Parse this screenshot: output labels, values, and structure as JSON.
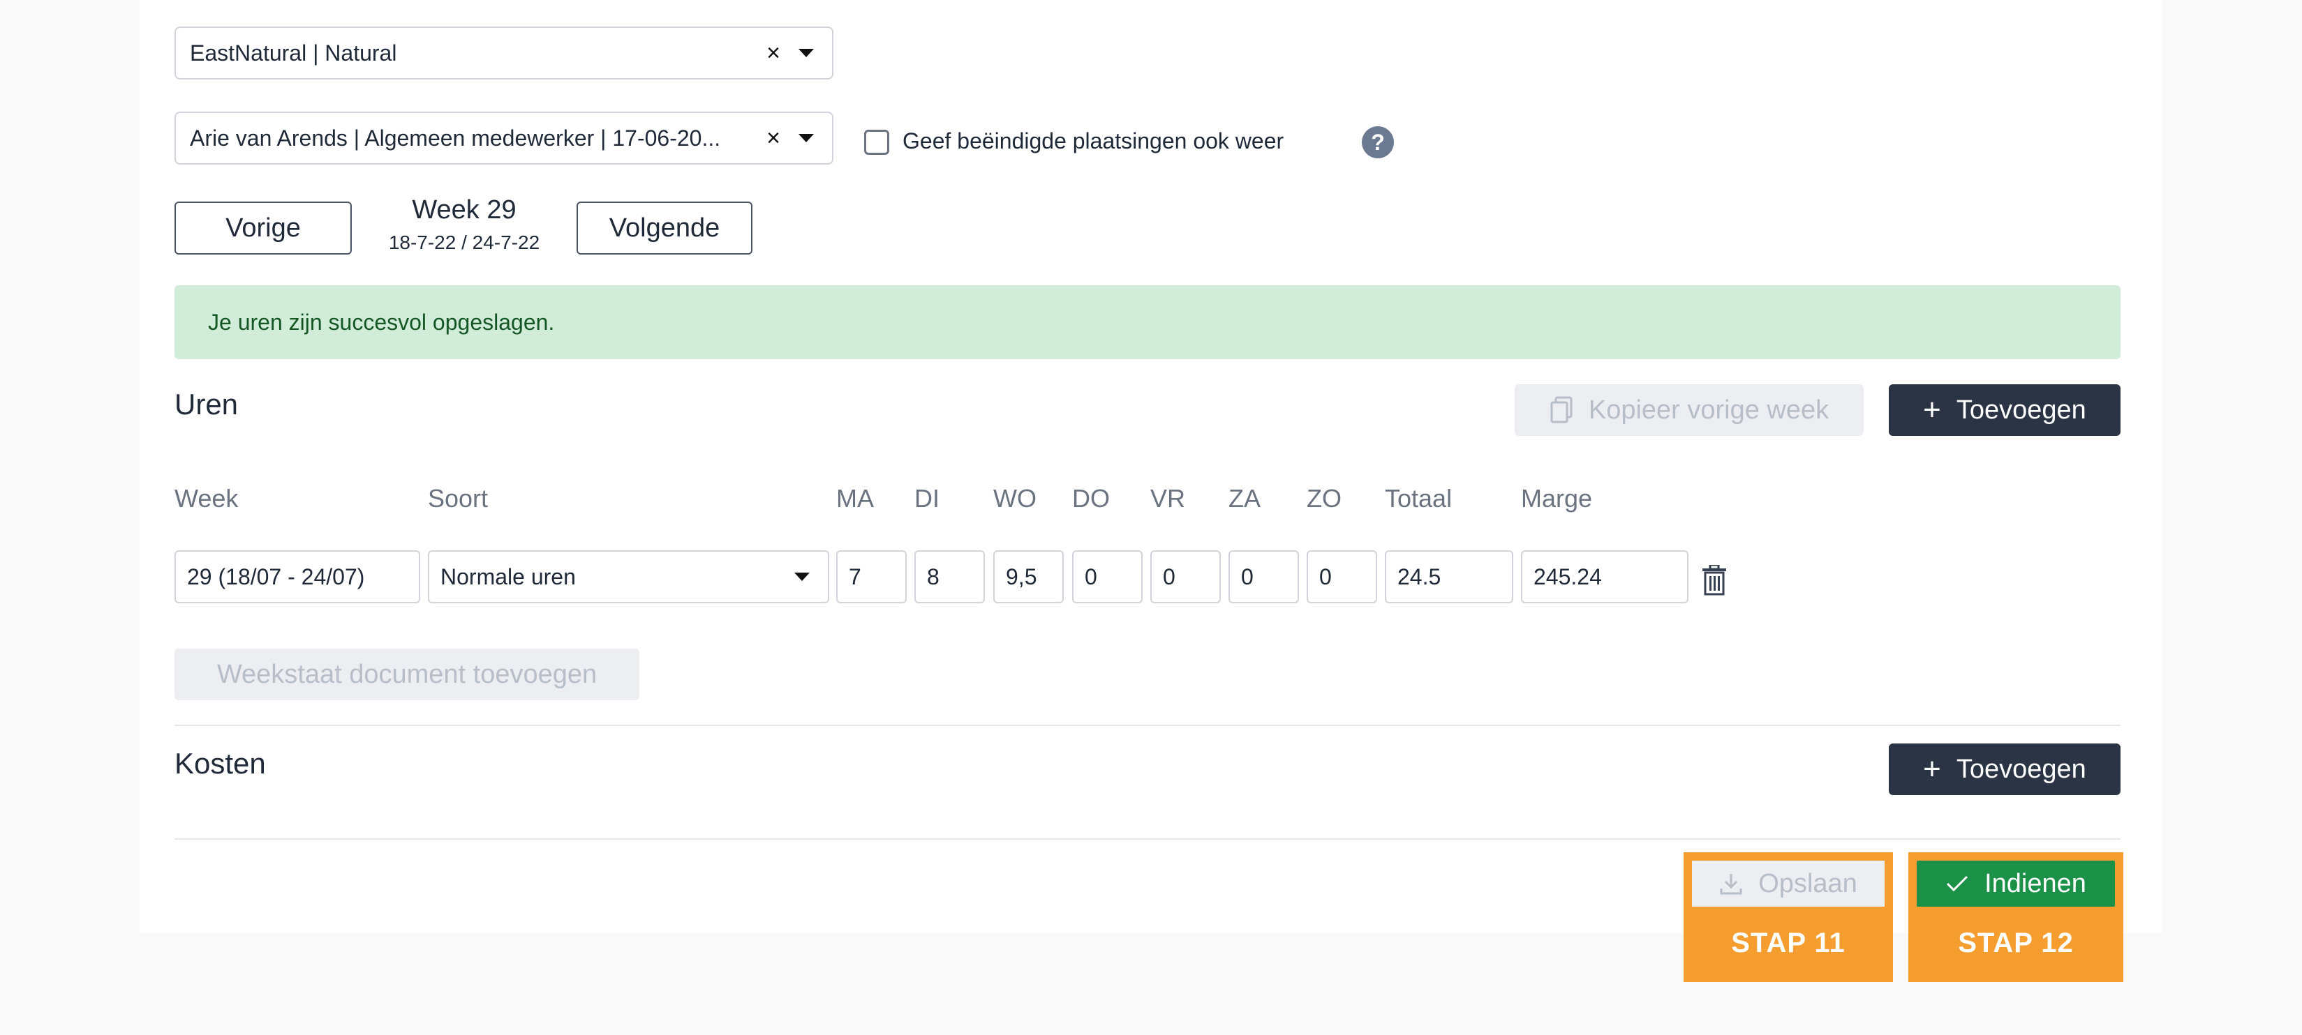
{
  "filters": {
    "company_value": "EastNatural | Natural",
    "placement_value": "Arie van Arends | Algemeen medewerker | 17-06-20...",
    "clear_symbol": "×",
    "show_ended_label": "Geef beëindigde plaatsingen ook weer",
    "help_symbol": "?"
  },
  "week_nav": {
    "prev_label": "Vorige",
    "next_label": "Volgende",
    "week_title": "Week 29",
    "week_range": "18-7-22 / 24-7-22"
  },
  "alert": {
    "message": "Je uren zijn succesvol opgeslagen."
  },
  "hours": {
    "title": "Uren",
    "copy_label": "Kopieer vorige week",
    "add_label": "Toevoegen",
    "columns": [
      "Week",
      "Soort",
      "MA",
      "DI",
      "WO",
      "DO",
      "VR",
      "ZA",
      "ZO",
      "Totaal",
      "Marge"
    ],
    "row": {
      "week": "29 (18/07 - 24/07)",
      "type": "Normale uren",
      "days": [
        "7",
        "8",
        "9,5",
        "0",
        "0",
        "0",
        "0"
      ],
      "total": "24.5",
      "margin": "245.24"
    },
    "attach_label": "Weekstaat document toevoegen"
  },
  "costs": {
    "title": "Kosten",
    "add_label": "Toevoegen"
  },
  "footer": {
    "save_label": "Opslaan",
    "submit_label": "Indienen",
    "step_save": "STAP 11",
    "step_submit": "STAP 12"
  },
  "colors": {
    "primary_dark": "#2b3444",
    "success_bg": "#d1ecd8",
    "success_text": "#155724",
    "submit_green": "#1b9148",
    "step_orange": "#f59d2f"
  }
}
